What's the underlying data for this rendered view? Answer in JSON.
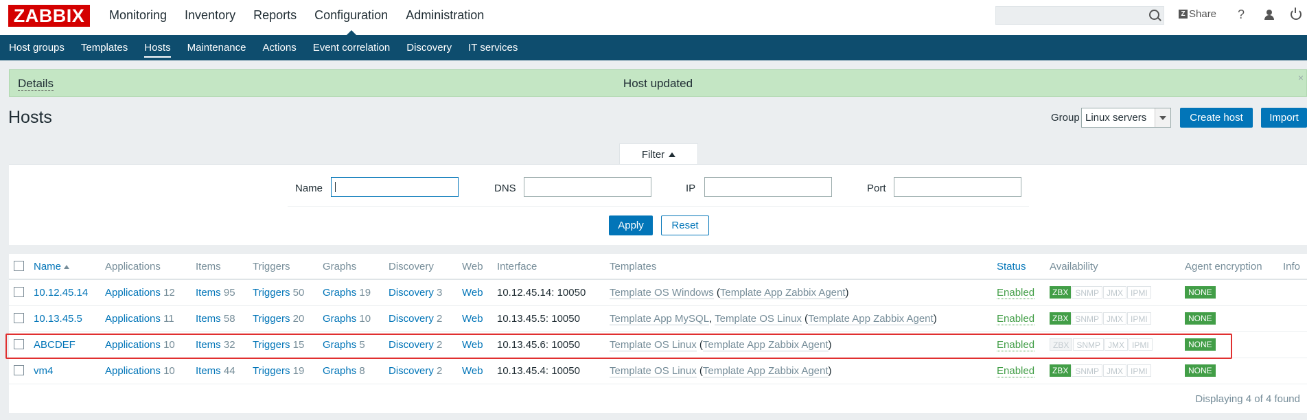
{
  "logo": "ZABBIX",
  "top_menu": [
    "Monitoring",
    "Inventory",
    "Reports",
    "Configuration",
    "Administration"
  ],
  "top_right": {
    "share": "Share",
    "help": "?"
  },
  "sub_menu": [
    "Host groups",
    "Templates",
    "Hosts",
    "Maintenance",
    "Actions",
    "Event correlation",
    "Discovery",
    "IT services"
  ],
  "message": {
    "details": "Details",
    "text": "Host updated",
    "close": "×"
  },
  "page": {
    "title": "Hosts",
    "group_label": "Group",
    "group_value": "Linux servers",
    "create_host": "Create host",
    "import": "Import"
  },
  "filter": {
    "tab": "Filter",
    "name_label": "Name",
    "dns_label": "DNS",
    "ip_label": "IP",
    "port_label": "Port",
    "apply": "Apply",
    "reset": "Reset"
  },
  "table": {
    "columns": [
      "Name",
      "Applications",
      "Items",
      "Triggers",
      "Graphs",
      "Discovery",
      "Web",
      "Interface",
      "Templates",
      "Status",
      "Availability",
      "Agent encryption",
      "Info"
    ],
    "rows": [
      {
        "name": "10.12.45.14",
        "apps": "12",
        "items": "95",
        "triggers": "50",
        "graphs": "19",
        "discovery": "3",
        "web": "Web",
        "interface": "10.12.45.14: 10050",
        "templates": [
          {
            "name": "Template OS Windows",
            "suffix": " ("
          },
          {
            "name": "Template App Zabbix Agent",
            "suffix": ")"
          }
        ],
        "status": "Enabled",
        "zbx_on": true,
        "encryption": "NONE"
      },
      {
        "name": "10.13.45.5",
        "apps": "11",
        "items": "58",
        "triggers": "20",
        "graphs": "10",
        "discovery": "2",
        "web": "Web",
        "interface": "10.13.45.5: 10050",
        "templates": [
          {
            "name": "Template App MySQL",
            "suffix": ", "
          },
          {
            "name": "Template OS Linux",
            "suffix": " ("
          },
          {
            "name": "Template App Zabbix Agent",
            "suffix": ")"
          }
        ],
        "status": "Enabled",
        "zbx_on": true,
        "encryption": "NONE"
      },
      {
        "name": "ABCDEF",
        "apps": "10",
        "items": "32",
        "triggers": "15",
        "graphs": "5",
        "discovery": "2",
        "web": "Web",
        "interface": "10.13.45.6: 10050",
        "templates": [
          {
            "name": "Template OS Linux",
            "suffix": " ("
          },
          {
            "name": "Template App Zabbix Agent",
            "suffix": ")"
          }
        ],
        "status": "Enabled",
        "zbx_on": false,
        "encryption": "NONE"
      },
      {
        "name": "vm4",
        "apps": "10",
        "items": "44",
        "triggers": "19",
        "graphs": "8",
        "discovery": "2",
        "web": "Web",
        "interface": "10.13.45.4: 10050",
        "templates": [
          {
            "name": "Template OS Linux",
            "suffix": " ("
          },
          {
            "name": "Template App Zabbix Agent",
            "suffix": ")"
          }
        ],
        "status": "Enabled",
        "zbx_on": true,
        "encryption": "NONE"
      }
    ],
    "link_labels": {
      "applications": "Applications",
      "items": "Items",
      "triggers": "Triggers",
      "graphs": "Graphs",
      "discovery": "Discovery"
    },
    "availability_labels": [
      "ZBX",
      "SNMP",
      "JMX",
      "IPMI"
    ],
    "footer": "Displaying 4 of 4 found"
  }
}
